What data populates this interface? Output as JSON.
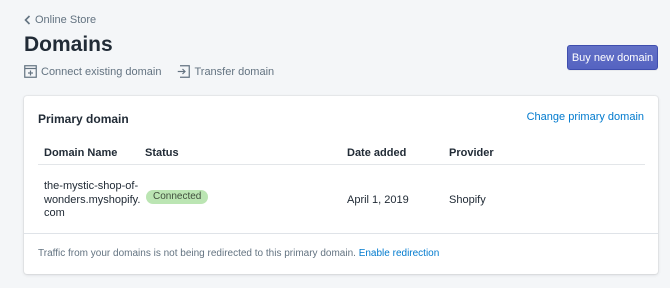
{
  "breadcrumb": {
    "label": "Online Store"
  },
  "page": {
    "title": "Domains"
  },
  "actions": {
    "connect_label": "Connect existing domain",
    "transfer_label": "Transfer domain"
  },
  "buy_button": {
    "label": "Buy new domain"
  },
  "card": {
    "title": "Primary domain",
    "change_link": "Change primary domain",
    "columns": [
      "Domain Name",
      "Status",
      "Date added",
      "Provider"
    ],
    "rows": [
      {
        "domain_name_lines": [
          "the-mystic-shop-of-",
          "wonders.myshopify.",
          "com"
        ],
        "status": "Connected",
        "date_added": "April 1, 2019",
        "provider": "Shopify"
      }
    ],
    "footer_text": "Traffic from your domains is not being redirected to this primary domain.",
    "footer_link": "Enable redirection"
  },
  "colors": {
    "accent": "#5c6ac4",
    "link": "#007ace",
    "badge_success_bg": "#bbe5b3",
    "background": "#f4f6f8"
  },
  "icons": {
    "breadcrumb": "chevron-left-icon",
    "connect": "connect-domain-icon",
    "transfer": "transfer-domain-icon"
  }
}
